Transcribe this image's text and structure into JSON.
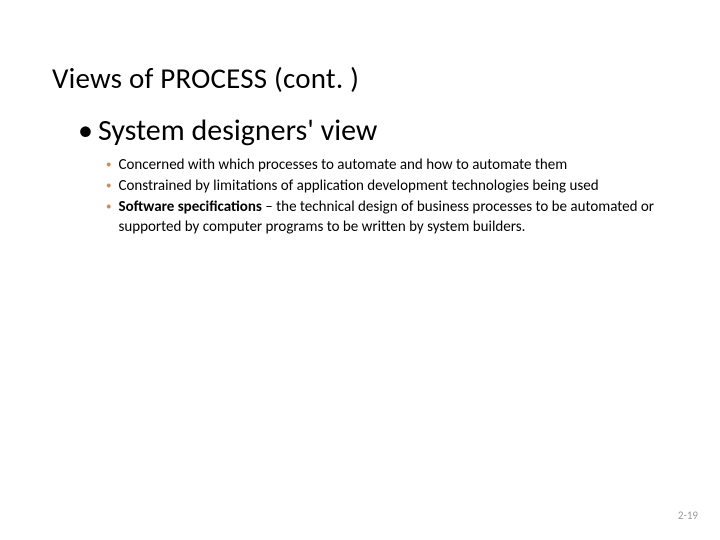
{
  "title": "Views of PROCESS (cont. )",
  "main": {
    "bullet": "•",
    "text": "System designers' view"
  },
  "subs": {
    "bullet": "•",
    "item1": "Concerned with which processes to automate and how to automate them",
    "item2": "Constrained by limitations of application development technologies being used",
    "item3_bold": "Software specifications",
    "item3_rest": " – the technical design of business processes to be automated or supported by computer programs to be written by system builders."
  },
  "pageno": "2-19"
}
